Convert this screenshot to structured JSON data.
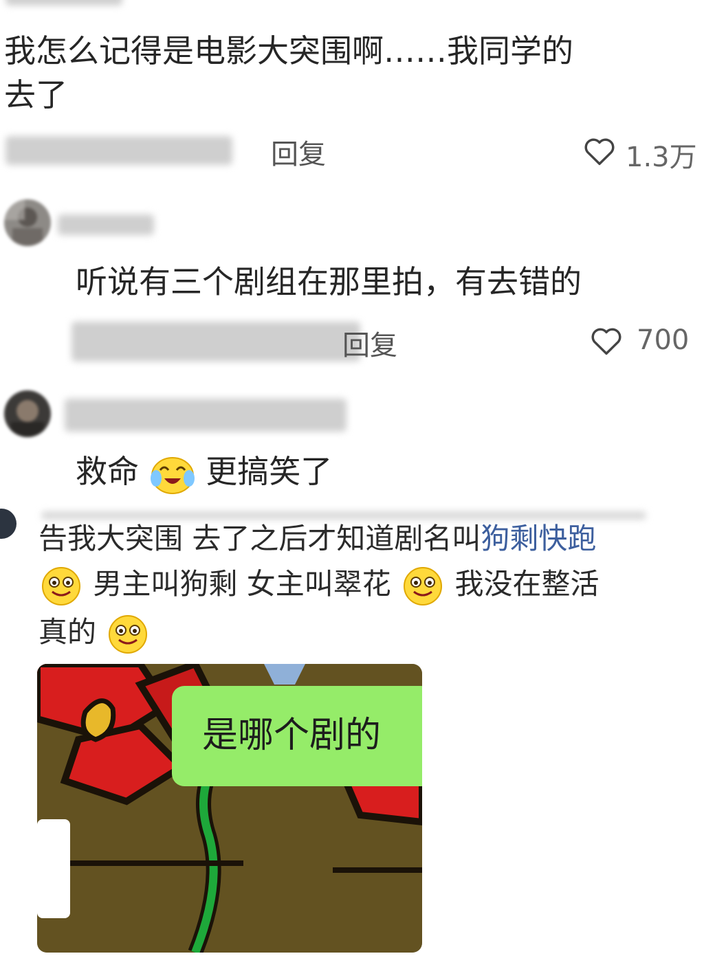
{
  "comment1": {
    "line1": "我怎么记得是电影大突围啊……我同学的",
    "line2": "去了",
    "reply_label": "回复",
    "likes": "1.3万"
  },
  "comment2": {
    "text": "听说有三个剧组在那里拍，有去错的",
    "reply_label": "回复",
    "likes": "700"
  },
  "comment3": {
    "text_a": "救命",
    "text_b": "更搞笑了"
  },
  "post": {
    "line1_a": "告我大突围 去了之后才知道剧名叫",
    "line1_link": "狗剩快跑",
    "line2_a": "男主叫狗剩 女主叫翠花",
    "line2_b": "我没在整活",
    "line3": "真的"
  },
  "screenshot": {
    "bubble_text": "是哪个剧的"
  },
  "colors": {
    "bubble": "#95ec69",
    "painting_bg": "#5a4a1e",
    "petal": "#d81e1e",
    "stem": "#1ea83a",
    "link": "#3d5f9e"
  }
}
